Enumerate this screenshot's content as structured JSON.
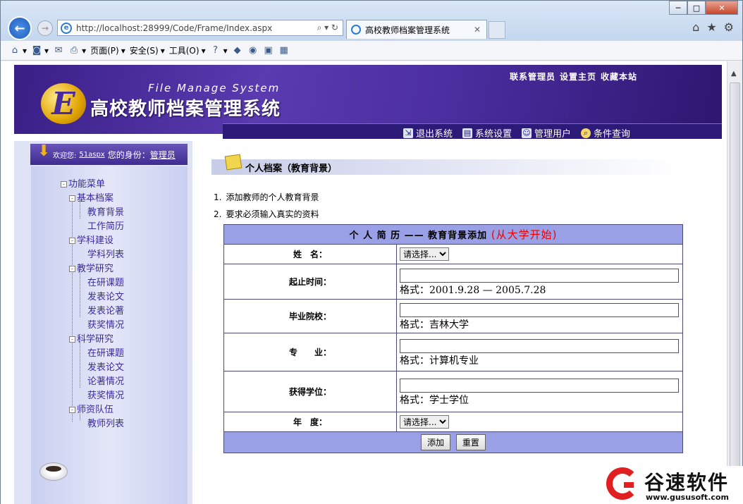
{
  "browser": {
    "url": "http://localhost:28999/Code/Frame/Index.aspx",
    "tab_title": "高校教师档案管理系统",
    "cmd": {
      "page": "页面(P)",
      "safety": "安全(S)",
      "tools": "工具(O)"
    }
  },
  "banner": {
    "links": [
      "联系管理员",
      "设置主页",
      "收藏本站"
    ],
    "subtitle": "File Manage System",
    "title": "高校教师档案管理系统",
    "logo_letter": "E",
    "nav": [
      {
        "label": "退出系统",
        "icon": "exit-icon"
      },
      {
        "label": "系统设置",
        "icon": "settings-icon"
      },
      {
        "label": "管理用户",
        "icon": "users-icon"
      },
      {
        "label": "条件查询",
        "icon": "search-icon"
      }
    ]
  },
  "user": {
    "welcome": "欢迎您:",
    "name": "51aspx",
    "identity": "您的身份：",
    "role": "管理员"
  },
  "tree": {
    "root": "功能菜单",
    "groups": [
      {
        "label": "基本档案",
        "items": [
          "教育背景",
          "工作简历"
        ]
      },
      {
        "label": "学科建设",
        "items": [
          "学科列表"
        ]
      },
      {
        "label": "教学研究",
        "items": [
          "在研课题",
          "发表论文",
          "发表论著",
          "获奖情况"
        ]
      },
      {
        "label": "科学研究",
        "items": [
          "在研课题",
          "发表论文",
          "论著情况",
          "获奖情况"
        ]
      },
      {
        "label": "师资队伍",
        "items": [
          "教师列表"
        ]
      }
    ]
  },
  "content": {
    "section_title": "个人档案（教育背景）",
    "notes": [
      "添加教师的个人教育背景",
      "要求必须输入真实的资料"
    ],
    "form": {
      "header": "个 人 简 历 —— 教育背景添加",
      "header_red": "(从大学开始)",
      "name_label": "姓　名：",
      "select_placeholder": "请选择...",
      "period_label": "起止时间：",
      "period_hint": "格式：2001.9.28 — 2005.7.28",
      "school_label": "毕业院校：",
      "school_hint": "格式：吉林大学",
      "major_label": "专　　业：",
      "major_hint": "格式：计算机专业",
      "degree_label": "获得学位：",
      "degree_hint": "格式：学士学位",
      "year_label": "年　度：",
      "add_button": "添加",
      "reset_button": "重置"
    }
  },
  "watermark": {
    "name": "谷速软件",
    "url": "www.gususoft.com"
  }
}
